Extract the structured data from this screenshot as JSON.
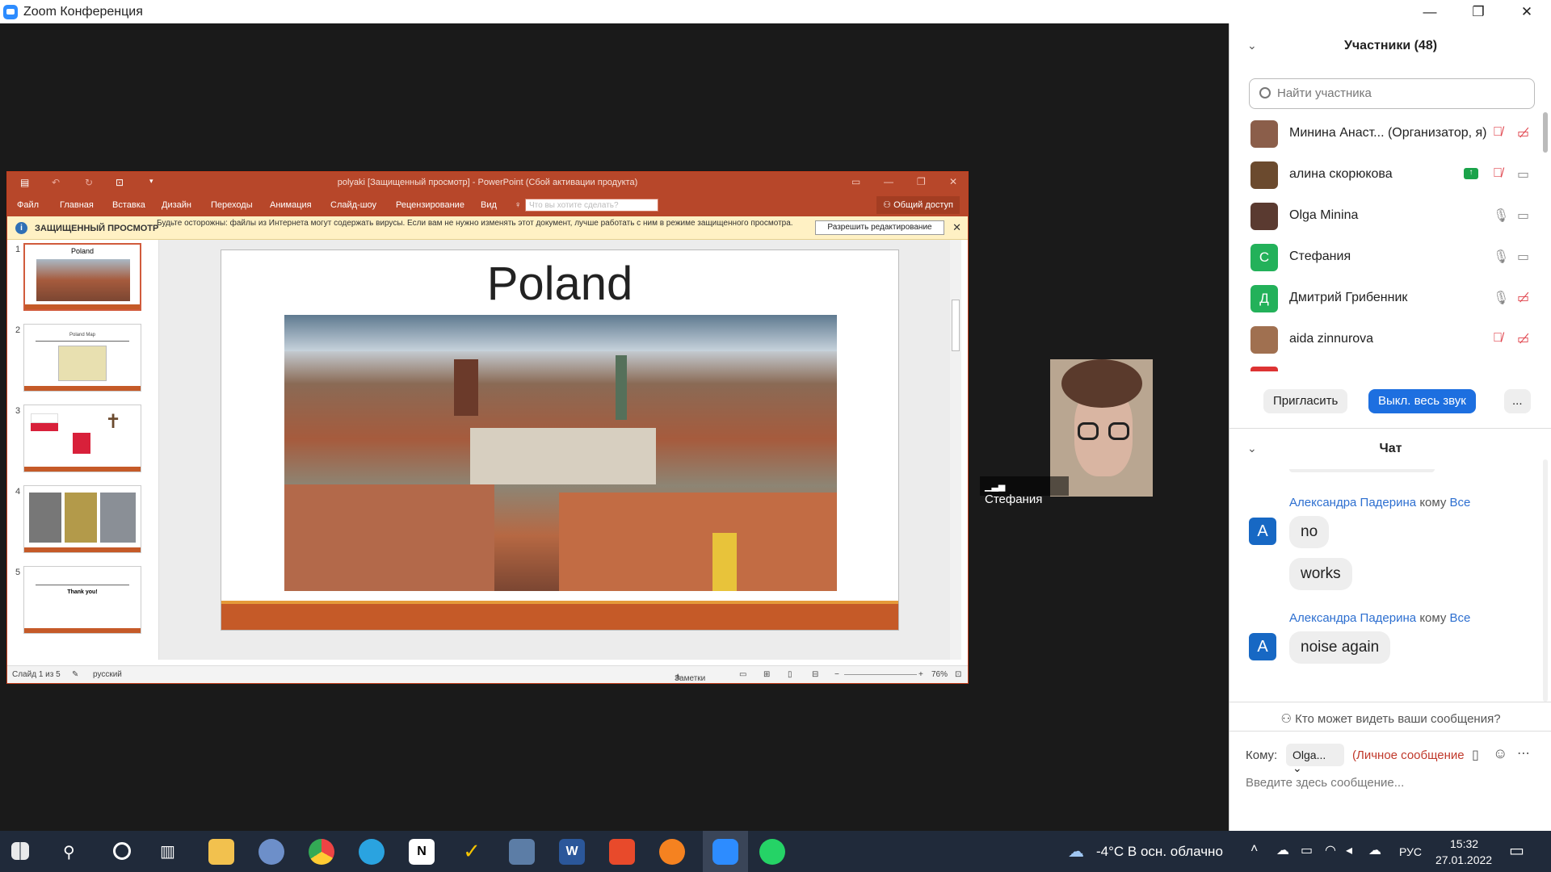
{
  "window": {
    "title": "Zoom Конференция",
    "min": "—",
    "max": "❐",
    "close": "✕"
  },
  "ppt": {
    "title": "polyaki [Защищенный просмотр] - PowerPoint (Сбой активации продукта)",
    "menu": [
      "Файл",
      "Главная",
      "Вставка",
      "Дизайн",
      "Переходы",
      "Анимация",
      "Слайд-шоу",
      "Рецензирование",
      "Вид"
    ],
    "search_placeholder": "Что вы хотите сделать?",
    "share": "Общий доступ",
    "protected_label": "ЗАЩИЩЕННЫЙ ПРОСМОТР",
    "protected_msg": "Будьте осторожны: файлы из Интернета могут содержать вирусы. Если вам не нужно изменять этот документ, лучше работать с ним в режиме защищенного просмотра.",
    "enable_edit": "Разрешить редактирование",
    "thumbs": [
      {
        "num": "1",
        "text": "Poland"
      },
      {
        "num": "2",
        "text": "Poland Map"
      },
      {
        "num": "3",
        "text": ""
      },
      {
        "num": "4",
        "text": ""
      },
      {
        "num": "5",
        "text": "Thank you!"
      }
    ],
    "slide_title": "Poland",
    "status_slide": "Слайд 1 из 5",
    "status_lang": "русский",
    "status_notes": "Заметки",
    "zoom": "76%"
  },
  "self_video": {
    "name": "Стефания"
  },
  "participants": {
    "header": "Участники (48)",
    "search_placeholder": "Найти участника",
    "list": [
      {
        "name": "Минина Анаст...",
        "role": "(Организатор, я)",
        "avatar": "",
        "color": "#8b5e4a"
      },
      {
        "name": "алина скорюкова",
        "role": "",
        "avatar": "",
        "color": "#6b4a2e"
      },
      {
        "name": "Olga Minina",
        "role": "",
        "avatar": "",
        "color": "#5a3a30"
      },
      {
        "name": "Стефания",
        "role": "",
        "avatar": "С",
        "color": "#23b15a"
      },
      {
        "name": "Дмитрий Грибенник",
        "role": "",
        "avatar": "Д",
        "color": "#23b15a"
      },
      {
        "name": "aida zinnurova",
        "role": "",
        "avatar": "",
        "color": "#a07050"
      }
    ],
    "invite": "Пригласить",
    "mute_all": "Выкл. весь звук",
    "more": "..."
  },
  "chat": {
    "header": "Чат",
    "messages": [
      {
        "sender": "Александра Падерина",
        "to_word": "кому",
        "to": "Все",
        "avatar": "A",
        "lines": [
          "no",
          "works"
        ]
      },
      {
        "sender": "Александра Падерина",
        "to_word": "кому",
        "to": "Все",
        "avatar": "A",
        "lines": [
          "noise again"
        ]
      }
    ],
    "who_can_see": "Кто может видеть ваши сообщения?",
    "to_label": "Кому:",
    "to_value": "Olga...",
    "private": "(Личное сообщение",
    "input_placeholder": "Введите здесь сообщение..."
  },
  "taskbar": {
    "weather": "-4°C  В осн. облачно",
    "lang": "РУС",
    "time": "15:32",
    "date": "27.01.2022"
  }
}
